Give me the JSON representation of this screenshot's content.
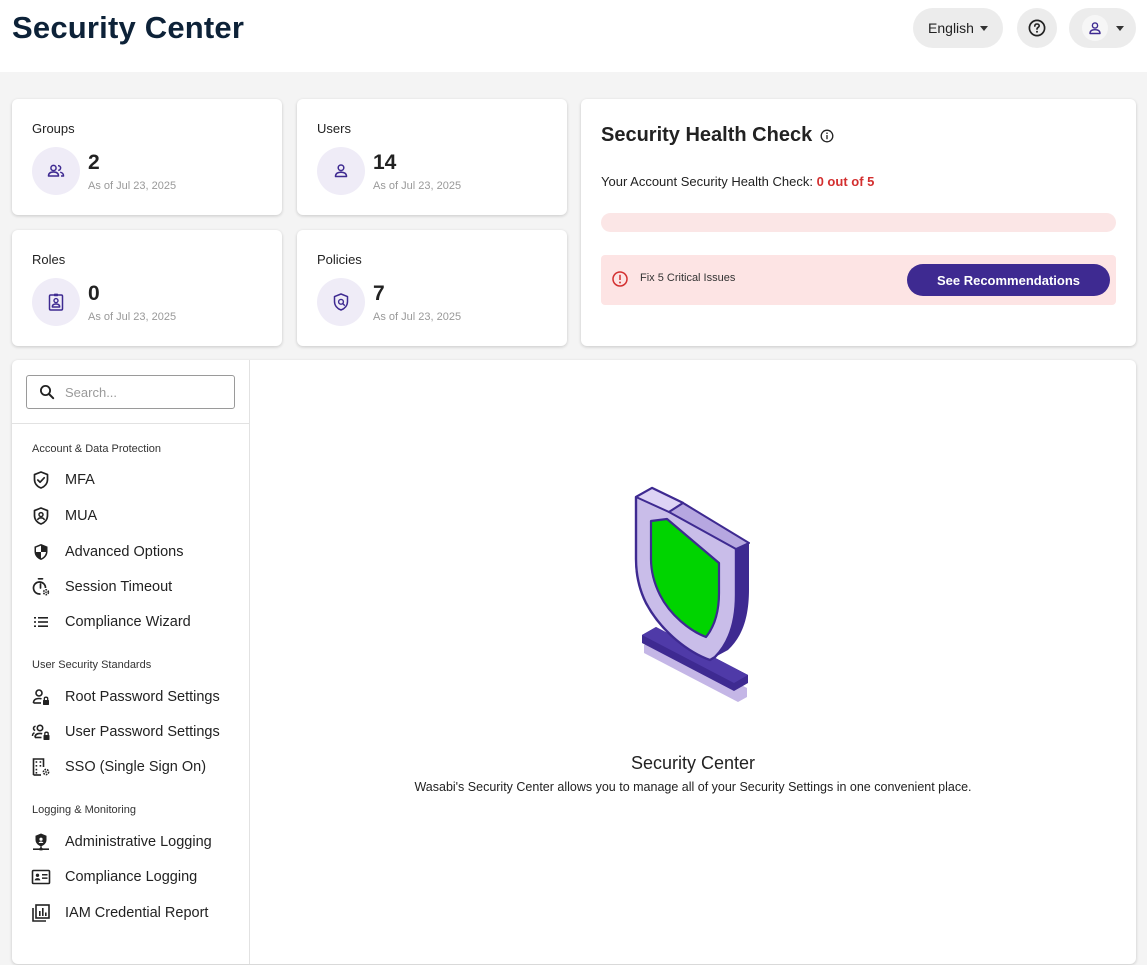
{
  "header": {
    "title": "Security Center",
    "language": "English"
  },
  "stats": [
    {
      "label": "Groups",
      "value": "2",
      "date": "As of Jul 23, 2025",
      "icon": "groups-icon"
    },
    {
      "label": "Users",
      "value": "14",
      "date": "As of Jul 23, 2025",
      "icon": "user-icon"
    },
    {
      "label": "Roles",
      "value": "0",
      "date": "As of Jul 23, 2025",
      "icon": "role-badge-icon"
    },
    {
      "label": "Policies",
      "value": "7",
      "date": "As of Jul 23, 2025",
      "icon": "policy-shield-icon"
    }
  ],
  "health": {
    "title": "Security Health Check",
    "text": "Your Account Security Health Check: ",
    "score": "0 out of 5",
    "progress": 0,
    "alert": "Fix 5 Critical Issues",
    "button": "See Recommendations",
    "accent_color": "#3e2a91",
    "critical_color": "#d32f2f"
  },
  "search": {
    "placeholder": "Search..."
  },
  "nav": {
    "sections": [
      {
        "title": "Account & Data Protection",
        "items": [
          "MFA",
          "MUA",
          "Advanced Options",
          "Session Timeout",
          "Compliance Wizard"
        ]
      },
      {
        "title": "User Security Standards",
        "items": [
          "Root Password Settings",
          "User Password Settings",
          "SSO (Single Sign On)"
        ]
      },
      {
        "title": "Logging & Monitoring",
        "items": [
          "Administrative Logging",
          "Compliance Logging",
          "IAM Credential Report"
        ]
      }
    ]
  },
  "content": {
    "title": "Security Center",
    "description": "Wasabi's Security Center allows you to manage all of your Security Settings in one convenient place."
  }
}
